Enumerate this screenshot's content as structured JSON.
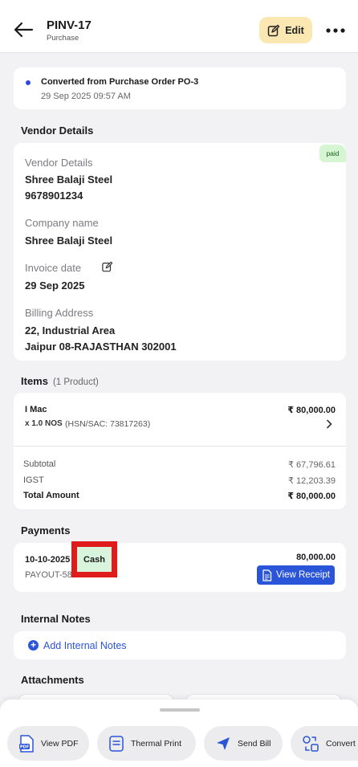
{
  "header": {
    "title": "PINV-17",
    "subtitle": "Purchase",
    "edit_label": "Edit"
  },
  "status": {
    "text": "Converted from Purchase Order PO-3",
    "time": "29 Sep 2025 09:57 AM"
  },
  "vendor_section": {
    "title": "Vendor Details",
    "badge": "paid",
    "vendor_label": "Vendor Details",
    "vendor_name": "Shree Balaji Steel",
    "vendor_phone": "9678901234",
    "company_label": "Company name",
    "company_value": "Shree Balaji Steel",
    "invoice_label": "Invoice date",
    "invoice_value": "29 Sep 2025",
    "billing_label": "Billing Address",
    "billing_line1": "22, Industrial Area",
    "billing_line2": "Jaipur 08-RAJASTHAN 302001"
  },
  "items_section": {
    "title": "Items",
    "count": "(1 Product)",
    "item": {
      "name": "I Mac",
      "price": "₹ 80,000.00",
      "qty": "x 1.0 NOS",
      "hsn": "(HSN/SAC: 73817263)"
    },
    "subtotal_label": "Subtotal",
    "subtotal_value": "₹ 67,796.61",
    "igst_label": "IGST",
    "igst_value": "₹ 12,203.39",
    "total_label": "Total Amount",
    "total_value": "₹ 80,000.00"
  },
  "payments_section": {
    "title": "Payments",
    "date": "10-10-2025",
    "ref": "PAYOUT-58",
    "mode": "Cash",
    "amount": "80,000.00",
    "receipt_label": "View Receipt"
  },
  "notes_section": {
    "title": "Internal Notes",
    "add_label": "Add Internal Notes"
  },
  "attachments_section": {
    "title": "Attachments"
  },
  "actions": {
    "view_pdf": "View PDF",
    "thermal_print": "Thermal Print",
    "send_bill": "Send Bill",
    "convert": "Convert"
  },
  "colors": {
    "accent": "#2b55d8",
    "edit_bg": "#fbe7b1",
    "paid_bg": "#d6f5d3",
    "highlight": "#e01b1b"
  }
}
